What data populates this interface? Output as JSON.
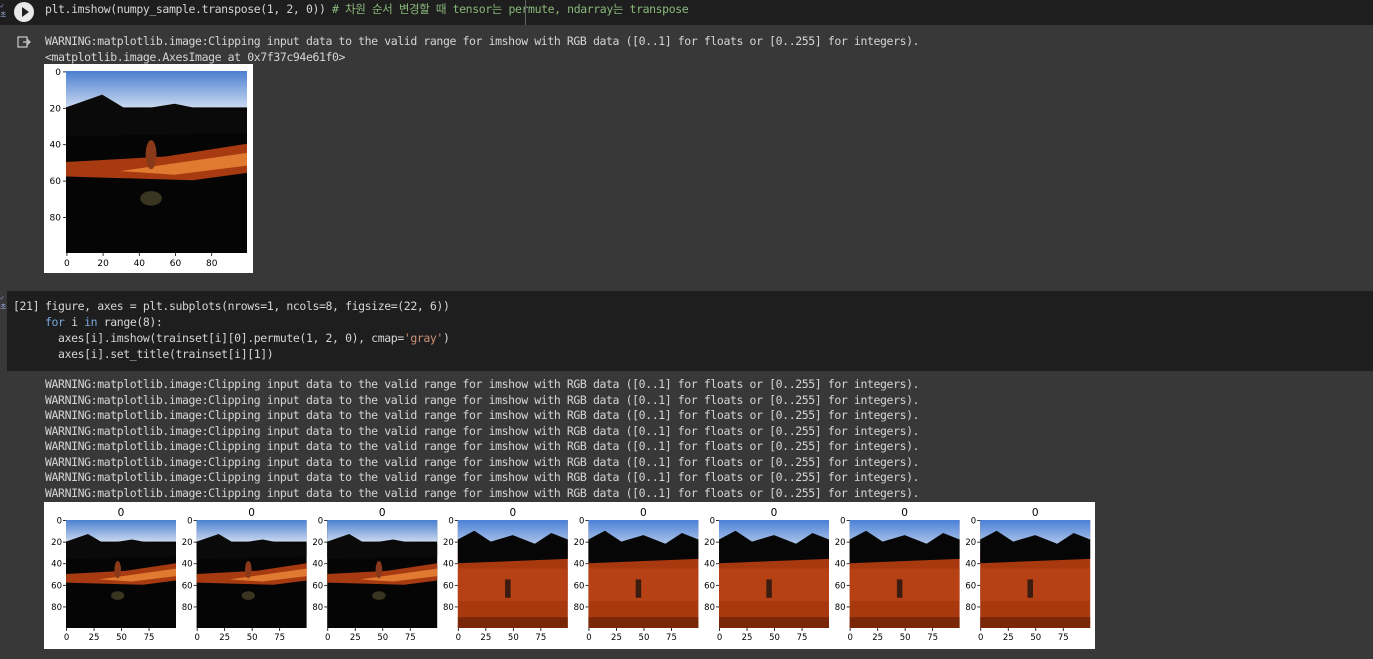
{
  "cell1": {
    "code_prefix": "plt.imshow(numpy_sample.transpose(1, 2, 0)) ",
    "code_comment": "# 차원 순서 변경할 때 tensor는 permute, ndarray는 transpose",
    "output_lines": [
      "WARNING:matplotlib.image:Clipping input data to the valid range for imshow with RGB data ([0..1] for floats or [0..255] for integers).",
      "<matplotlib.image.AxesImage at 0x7f37c94e61f0>"
    ],
    "plot": {
      "yticks": [
        "0",
        "20",
        "40",
        "60",
        "80"
      ],
      "xticks": [
        "0",
        "20",
        "40",
        "60",
        "80"
      ]
    }
  },
  "cell2": {
    "exec_count": "[21]",
    "code_lines": [
      "figure, axes = plt.subplots(nrows=1, ncols=8, figsize=(22, 6))",
      "for i in range(8):",
      "  axes[i].imshow(trainset[i][0].permute(1, 2, 0), cmap='gray')",
      "  axes[i].set_title(trainset[i][1])"
    ],
    "warning_line": "WARNING:matplotlib.image:Clipping input data to the valid range for imshow with RGB data ([0..1] for floats or [0..255] for integers).",
    "warning_count": 8,
    "subplots": {
      "titles": [
        "0",
        "0",
        "0",
        "0",
        "0",
        "0",
        "0",
        "0"
      ],
      "yticks": [
        "0",
        "20",
        "40",
        "60",
        "80"
      ],
      "xticks": [
        "0",
        "25",
        "50",
        "75"
      ],
      "scenes": [
        "road",
        "road",
        "road",
        "field",
        "field",
        "field",
        "field",
        "field"
      ]
    }
  },
  "colors": {
    "background": "#383838",
    "code_background": "#1e1e1e",
    "comment": "#8ab87a",
    "string": "#ce9178",
    "keyword": "#7aa6da"
  }
}
